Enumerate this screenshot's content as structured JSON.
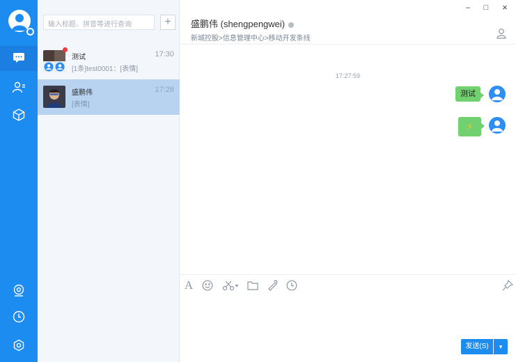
{
  "search": {
    "placeholder": "输入标题、拼音等进行查询",
    "add_label": "+"
  },
  "conversations": [
    {
      "name": "测试",
      "time": "17:30",
      "preview": "[1条]test0001：[表情]",
      "unread": true
    },
    {
      "name": "盛鹏伟",
      "time": "17:28",
      "preview": "[表情]",
      "selected": true
    }
  ],
  "chat": {
    "title": "盛鹏伟 (shengpengwei)",
    "department": "新城控股>信息管理中心>移动开发条线",
    "timestamp": "17:27:59",
    "messages": [
      {
        "type": "text",
        "text": "测试"
      },
      {
        "type": "emoji",
        "text": "⚡"
      }
    ]
  },
  "window": {
    "minimize": "–",
    "maximize": "□",
    "close": "×"
  },
  "composer": {
    "send_label": "发送(S)",
    "send_more": "▾"
  },
  "icons": {
    "rail": [
      "chat-icon",
      "contacts-icon",
      "apps-cube-icon",
      "location-icon",
      "history-clock-icon",
      "settings-icon"
    ],
    "toolbar": [
      "font-icon",
      "emoji-icon",
      "screenshot-scissors-icon",
      "folder-icon",
      "shake-icon",
      "history-icon",
      "pin-icon"
    ]
  },
  "colors": {
    "accent": "#1d8cf0",
    "bubble": "#71d06f",
    "selected_row": "#b8d3ef",
    "unread": "#ee3a3a"
  }
}
